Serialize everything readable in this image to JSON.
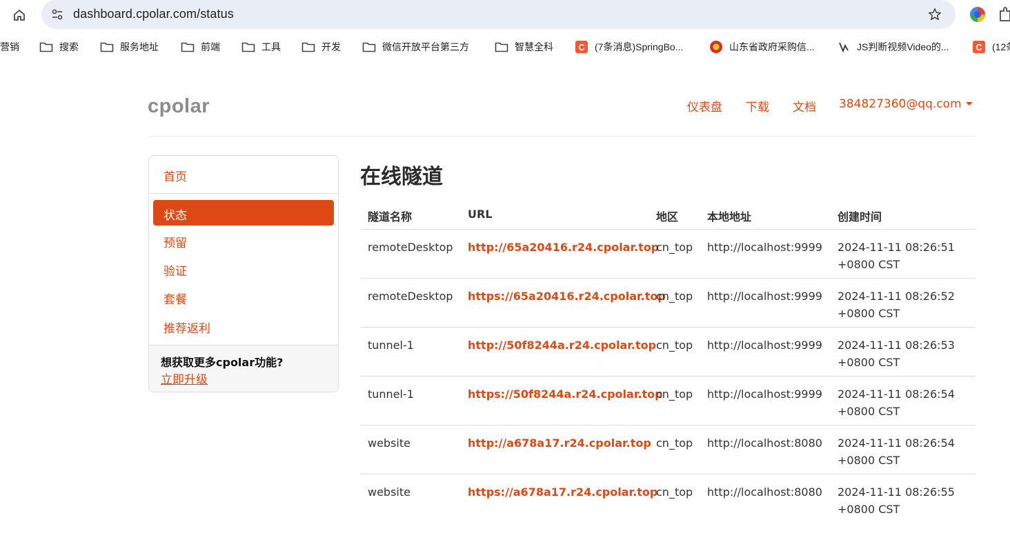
{
  "browser": {
    "url": "dashboard.cpolar.com/status",
    "bookmarks": [
      {
        "label": "营销",
        "icon": "none"
      },
      {
        "label": "搜索",
        "icon": "folder-icon"
      },
      {
        "label": "服务地址",
        "icon": "folder-icon"
      },
      {
        "label": "前端",
        "icon": "folder-icon"
      },
      {
        "label": "工具",
        "icon": "folder-icon"
      },
      {
        "label": "开发",
        "icon": "folder-icon"
      },
      {
        "label": "微信开放平台第三方",
        "icon": "folder-icon"
      },
      {
        "label": "智慧全科",
        "icon": "folder-icon"
      },
      {
        "label": "(7条消息)SpringBo...",
        "icon": "csdn-icon"
      },
      {
        "label": "山东省政府采购信...",
        "icon": "gov-emblem-icon"
      },
      {
        "label": "JS判断视频Video的...",
        "icon": "site-icon"
      },
      {
        "label": "(12条",
        "icon": "csdn-icon"
      }
    ]
  },
  "header": {
    "brand": "cpolar",
    "nav": {
      "dashboard": "仪表盘",
      "download": "下载",
      "docs": "文档",
      "account": "384827360@qq.com"
    }
  },
  "sidebar": {
    "home": "首页",
    "status": "状态",
    "reserved": "预留",
    "auth": "验证",
    "plans": "套餐",
    "referral": "推荐返利",
    "promo_title": "想获取更多cpolar功能?",
    "promo_link": "立即升级"
  },
  "main": {
    "title": "在线隧道",
    "columns": [
      "隧道名称",
      "URL",
      "地区",
      "本地地址",
      "创建时间"
    ],
    "rows": [
      {
        "name": "remoteDesktop",
        "url": "http://65a20416.r24.cpolar.top",
        "region": "cn_top",
        "local": "http://localhost:9999",
        "created": "2024-11-11 08:26:51",
        "tz": "+0800 CST"
      },
      {
        "name": "remoteDesktop",
        "url": "https://65a20416.r24.cpolar.top",
        "region": "cn_top",
        "local": "http://localhost:9999",
        "created": "2024-11-11 08:26:52",
        "tz": "+0800 CST"
      },
      {
        "name": "tunnel-1",
        "url": "http://50f8244a.r24.cpolar.top",
        "region": "cn_top",
        "local": "http://localhost:9999",
        "created": "2024-11-11 08:26:53",
        "tz": "+0800 CST"
      },
      {
        "name": "tunnel-1",
        "url": "https://50f8244a.r24.cpolar.top",
        "region": "cn_top",
        "local": "http://localhost:9999",
        "created": "2024-11-11 08:26:54",
        "tz": "+0800 CST"
      },
      {
        "name": "website",
        "url": "http://a678a17.r24.cpolar.top",
        "region": "cn_top",
        "local": "http://localhost:8080",
        "created": "2024-11-11 08:26:54",
        "tz": "+0800 CST"
      },
      {
        "name": "website",
        "url": "https://a678a17.r24.cpolar.top",
        "region": "cn_top",
        "local": "http://localhost:8080",
        "created": "2024-11-11 08:26:55",
        "tz": "+0800 CST"
      }
    ]
  },
  "colors": {
    "accent": "#dd4814",
    "brand_gray": "#8c8c8c",
    "omnibox_bg": "#e9eef6"
  }
}
